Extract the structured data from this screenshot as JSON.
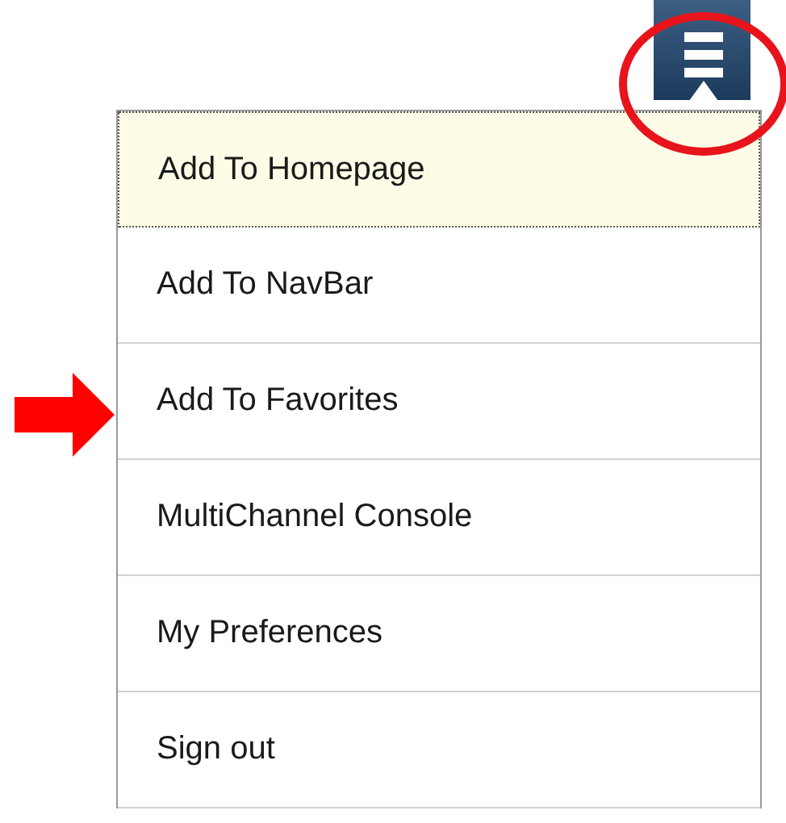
{
  "menu": {
    "items": [
      {
        "label": "Add To Homepage",
        "selected": true
      },
      {
        "label": "Add To NavBar",
        "selected": false
      },
      {
        "label": "Add To Favorites",
        "selected": false
      },
      {
        "label": "MultiChannel Console",
        "selected": false
      },
      {
        "label": "My Preferences",
        "selected": false
      },
      {
        "label": "Sign out",
        "selected": false
      }
    ]
  }
}
